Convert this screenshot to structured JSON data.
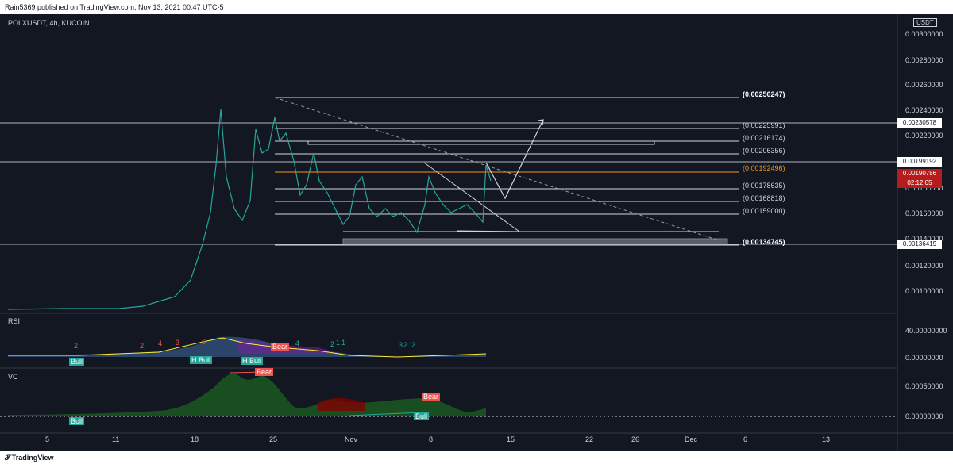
{
  "header": {
    "published_text": "Rain5369 published on TradingView.com, Nov 13, 2021 00:47 UTC-5"
  },
  "footer": {
    "logo_text": "TradingView"
  },
  "symbol": "POLXUSDT, 4h, KUCOIN",
  "unit": "USDT",
  "price_axis": [
    "0.00300000",
    "0.00280000",
    "0.00260000",
    "0.00240000",
    "0.00220000",
    "0.00180000",
    "0.00160000",
    "0.00140000",
    "0.00120000",
    "0.00100000"
  ],
  "fib_levels": [
    "(0.00250247)",
    "(0.00225991)",
    "(0.00216174)",
    "(0.00206356)",
    "(0.00192496)",
    "(0.00178635)",
    "(0.00168818)",
    "(0.00159000)",
    "(0.00134745)"
  ],
  "price_tags": {
    "level_1": "0.00230578",
    "level_2": "0.00199192",
    "current_price": "0.00190756",
    "countdown": "02:12:05",
    "level_3": "0.00136419"
  },
  "rsi": {
    "label": "RSI",
    "axis": [
      "40.00000000",
      "0.00000000"
    ],
    "tags": [
      "Bull",
      "H Bull",
      "H Bull",
      "Bear"
    ],
    "numbers": [
      "2",
      "2",
      "4",
      "3",
      "6",
      "4",
      "2",
      "1",
      "1",
      "3",
      "2",
      "2"
    ]
  },
  "vc": {
    "label": "VC",
    "axis": [
      "0.00050000",
      "0.00000000"
    ],
    "tags": [
      "Bear",
      "Bull",
      "Bear",
      "Bull"
    ]
  },
  "time_axis": [
    "5",
    "11",
    "18",
    "25",
    "Nov",
    "8",
    "15",
    "22",
    "26",
    "Dec",
    "6",
    "13"
  ],
  "colors": {
    "bg": "#131722",
    "bull": "#26a69a",
    "bear": "#ef5350",
    "fib_orange": "#f7931a",
    "current_price_bg": "#b71c1c"
  }
}
